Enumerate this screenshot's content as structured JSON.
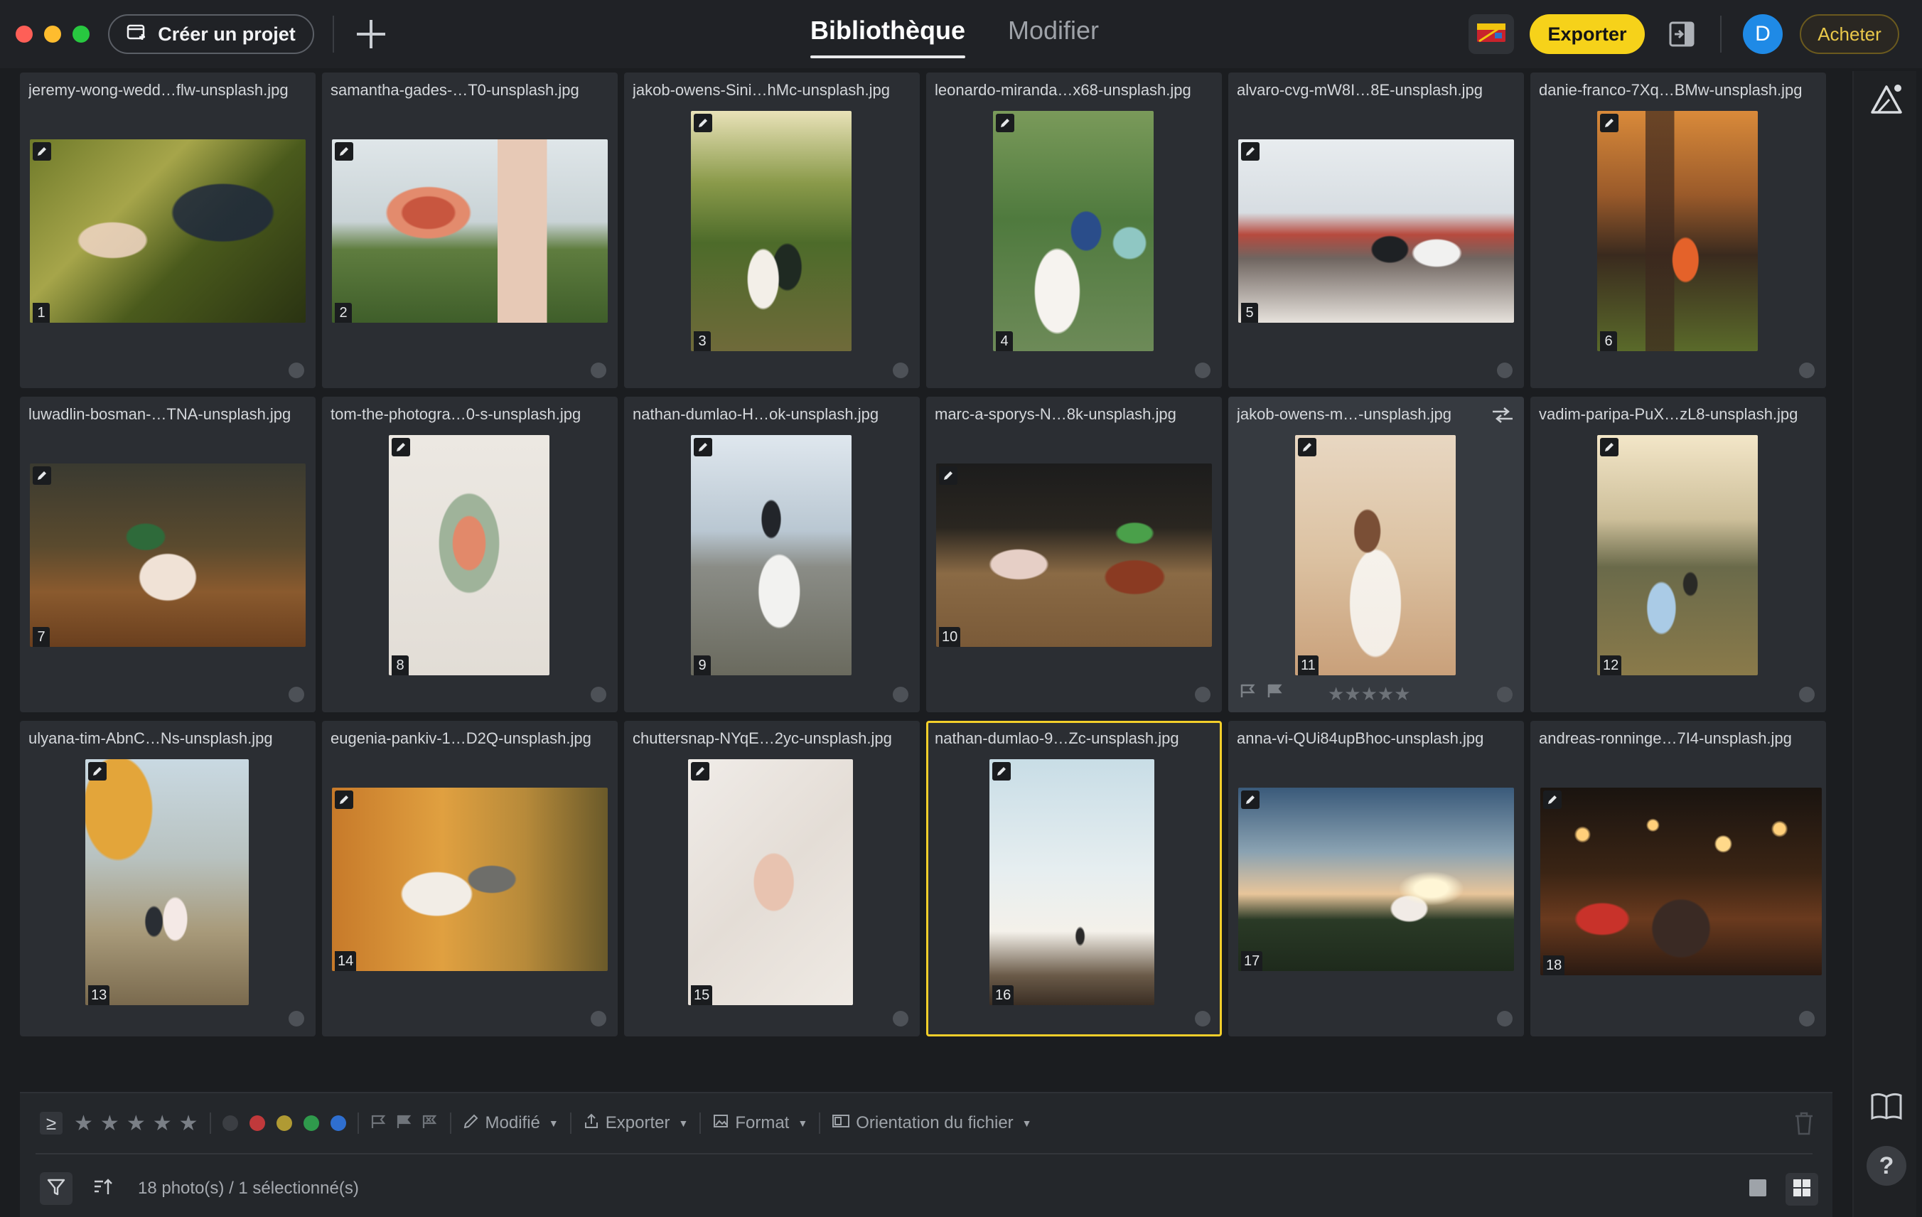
{
  "window": {
    "traffic_lights": {
      "close": "#fe5f57",
      "minimize": "#febc2e",
      "zoom": "#28c840"
    }
  },
  "topbar": {
    "create_project_label": "Créer un projet",
    "tab_library": "Bibliothèque",
    "tab_edit": "Modifier",
    "export_label": "Exporter",
    "avatar_letter": "D",
    "buy_label": "Acheter"
  },
  "accent": {
    "yellow": "#f6d21a",
    "selection": "#f3cf2a",
    "avatar": "#1f8ae6"
  },
  "photos": [
    {
      "filename": "jeremy-wong-wedd…flw-unsplash.jpg",
      "number": "1"
    },
    {
      "filename": "samantha-gades-…T0-unsplash.jpg",
      "number": "2"
    },
    {
      "filename": "jakob-owens-Sini…hMc-unsplash.jpg",
      "number": "3"
    },
    {
      "filename": "leonardo-miranda…x68-unsplash.jpg",
      "number": "4"
    },
    {
      "filename": "alvaro-cvg-mW8I…8E-unsplash.jpg",
      "number": "5"
    },
    {
      "filename": "danie-franco-7Xq…BMw-unsplash.jpg",
      "number": "6"
    },
    {
      "filename": "luwadlin-bosman-…TNA-unsplash.jpg",
      "number": "7"
    },
    {
      "filename": "tom-the-photogra…0-s-unsplash.jpg",
      "number": "8"
    },
    {
      "filename": "nathan-dumlao-H…ok-unsplash.jpg",
      "number": "9"
    },
    {
      "filename": "marc-a-sporys-N…8k-unsplash.jpg",
      "number": "10"
    },
    {
      "filename": "jakob-owens-m…-unsplash.jpg",
      "number": "11",
      "rating_stars": "★★★★★"
    },
    {
      "filename": "vadim-paripa-PuX…zL8-unsplash.jpg",
      "number": "12"
    },
    {
      "filename": "ulyana-tim-AbnC…Ns-unsplash.jpg",
      "number": "13"
    },
    {
      "filename": "eugenia-pankiv-1…D2Q-unsplash.jpg",
      "number": "14"
    },
    {
      "filename": "chuttersnap-NYqE…2yc-unsplash.jpg",
      "number": "15"
    },
    {
      "filename": "nathan-dumlao-9…Zc-unsplash.jpg",
      "number": "16"
    },
    {
      "filename": "anna-vi-QUi84upBhoc-unsplash.jpg",
      "number": "17"
    },
    {
      "filename": "andreas-ronninge…7I4-unsplash.jpg",
      "number": "18"
    }
  ],
  "filters": {
    "gte_symbol": "≥",
    "stars": [
      "★",
      "★",
      "★",
      "★",
      "★"
    ],
    "color_labels": [
      "#3b3e43",
      "#c0393b",
      "#b09a33",
      "#2f9a4c",
      "#2f6fd0"
    ],
    "modified_label": "Modifié",
    "export_label": "Exporter",
    "format_label": "Format",
    "orientation_label": "Orientation du fichier"
  },
  "status": {
    "count_text": "18 photo(s) / 1 sélectionné(s)"
  }
}
